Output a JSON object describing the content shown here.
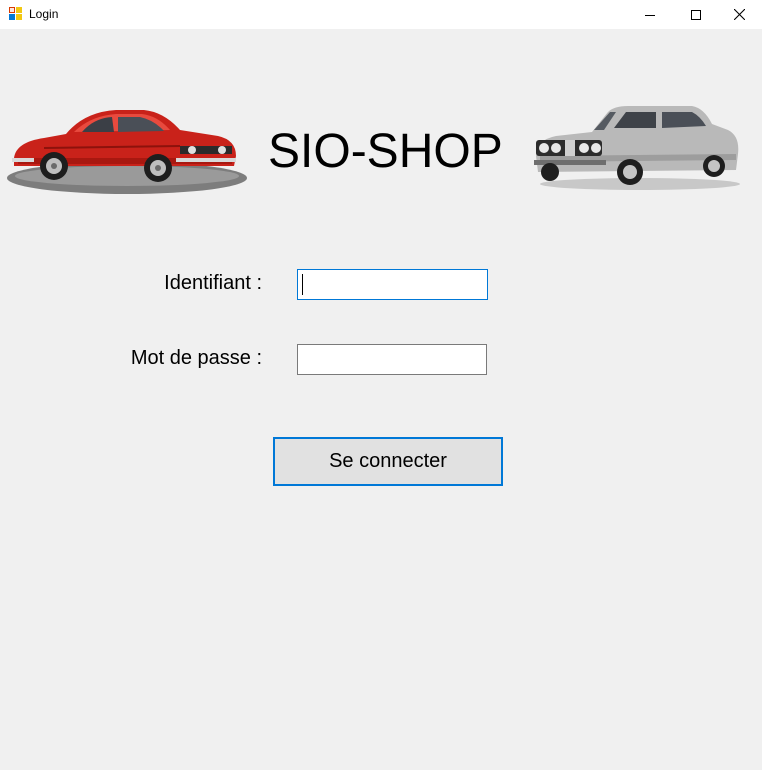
{
  "window": {
    "title": "Login",
    "icon": "app-form-icon",
    "controls": {
      "minimize": "minimize-icon",
      "maximize": "maximize-icon",
      "close": "close-icon"
    }
  },
  "header": {
    "brand": "SIO-SHOP",
    "left_car": "red-classic-coupe",
    "right_car": "silver-classic-sedan"
  },
  "form": {
    "username_label": "Identifiant :",
    "username_value": "",
    "password_label": "Mot de passe :",
    "password_value": "",
    "submit_label": "Se connecter"
  },
  "colors": {
    "background": "#f0f0f0",
    "focus_border": "#0078d7",
    "button_background": "#e1e1e1"
  }
}
